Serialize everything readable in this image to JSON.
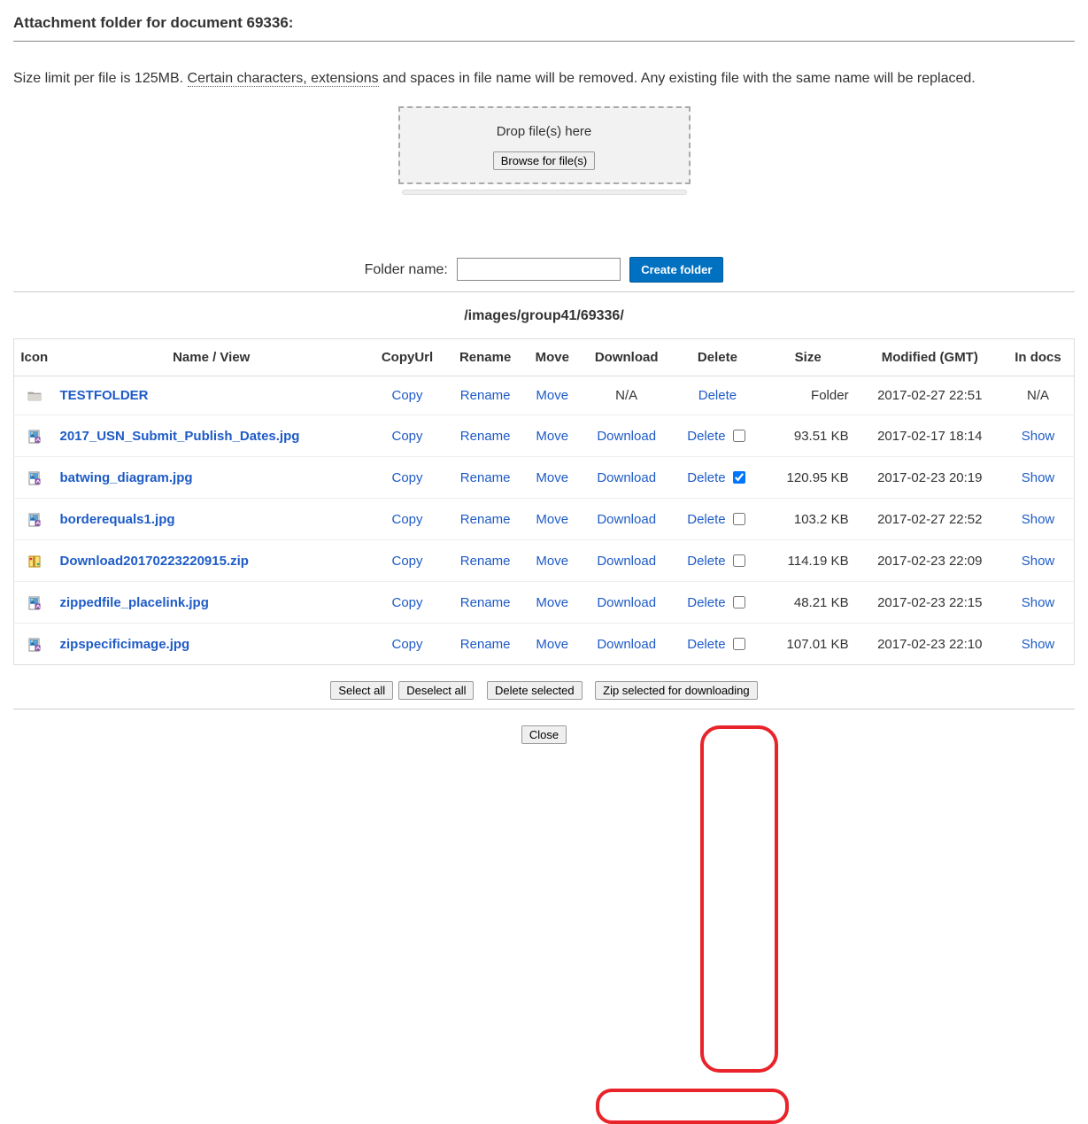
{
  "title": "Attachment folder for document 69336:",
  "intro_prefix": "Size limit per file is 125MB. ",
  "intro_dotted": "Certain characters, extensions",
  "intro_suffix": " and spaces in file name will be removed. Any existing file with the same name will be replaced.",
  "dropzone": {
    "label": "Drop file(s) here",
    "browse": "Browse for file(s)"
  },
  "folder": {
    "label": "Folder name:",
    "value": "",
    "create": "Create folder"
  },
  "path": "/images/group41/69336/",
  "columns": {
    "icon": "Icon",
    "name": "Name / View",
    "copy": "CopyUrl",
    "rename": "Rename",
    "move": "Move",
    "download": "Download",
    "delete": "Delete",
    "size": "Size",
    "modified": "Modified (GMT)",
    "docs": "In docs"
  },
  "actions": {
    "copy": "Copy",
    "rename": "Rename",
    "move": "Move",
    "download": "Download",
    "delete": "Delete",
    "na": "N/A",
    "show": "Show"
  },
  "rows": [
    {
      "type": "folder",
      "name": "TESTFOLDER",
      "download": "N/A",
      "delete_checkbox": null,
      "size": "Folder",
      "modified": "2017-02-27 22:51",
      "docs": "N/A"
    },
    {
      "type": "image",
      "name": "2017_USN_Submit_Publish_Dates.jpg",
      "download": "Download",
      "delete_checkbox": false,
      "size": "93.51 KB",
      "modified": "2017-02-17 18:14",
      "docs": "Show"
    },
    {
      "type": "image",
      "name": "batwing_diagram.jpg",
      "download": "Download",
      "delete_checkbox": true,
      "size": "120.95 KB",
      "modified": "2017-02-23 20:19",
      "docs": "Show"
    },
    {
      "type": "image",
      "name": "borderequals1.jpg",
      "download": "Download",
      "delete_checkbox": false,
      "size": "103.2 KB",
      "modified": "2017-02-27 22:52",
      "docs": "Show"
    },
    {
      "type": "zip",
      "name": "Download20170223220915.zip",
      "download": "Download",
      "delete_checkbox": false,
      "size": "114.19 KB",
      "modified": "2017-02-23 22:09",
      "docs": "Show"
    },
    {
      "type": "image",
      "name": "zippedfile_placelink.jpg",
      "download": "Download",
      "delete_checkbox": false,
      "size": "48.21 KB",
      "modified": "2017-02-23 22:15",
      "docs": "Show"
    },
    {
      "type": "image",
      "name": "zipspecificimage.jpg",
      "download": "Download",
      "delete_checkbox": false,
      "size": "107.01 KB",
      "modified": "2017-02-23 22:10",
      "docs": "Show"
    }
  ],
  "bulk": {
    "select_all": "Select all",
    "deselect_all": "Deselect all",
    "delete_selected": "Delete selected",
    "zip_selected": "Zip selected for downloading"
  },
  "close": "Close"
}
